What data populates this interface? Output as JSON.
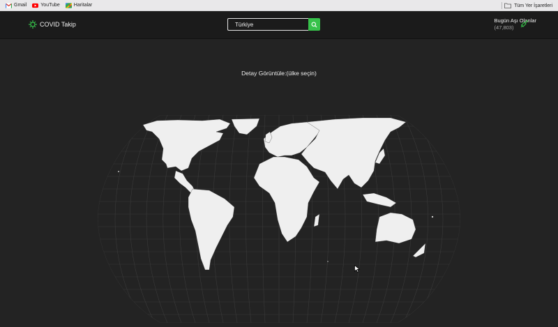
{
  "bookmarks": {
    "items": [
      {
        "label": "Gmail",
        "icon": "gmail-icon"
      },
      {
        "label": "YouTube",
        "icon": "youtube-icon"
      },
      {
        "label": "Haritalar",
        "icon": "maps-icon"
      }
    ],
    "all_bookmarks": {
      "label": "Tüm Yer İşaretleri",
      "icon": "folder-icon"
    }
  },
  "navbar": {
    "brand": "COVID Takip",
    "brand_icon": "virus-icon",
    "search": {
      "value": "Türkiye",
      "icon": "search-icon"
    },
    "vaccinated": {
      "label": "Bugün Aşı Olanlar",
      "count": "(47,803)",
      "icon": "syringe-icon"
    }
  },
  "main": {
    "hint": "Detay Görüntüle:(ülke seçin)"
  },
  "colors": {
    "background": "#232323",
    "navbar": "#1b1b1b",
    "accent": "#37c24b",
    "land": "#efefef"
  }
}
